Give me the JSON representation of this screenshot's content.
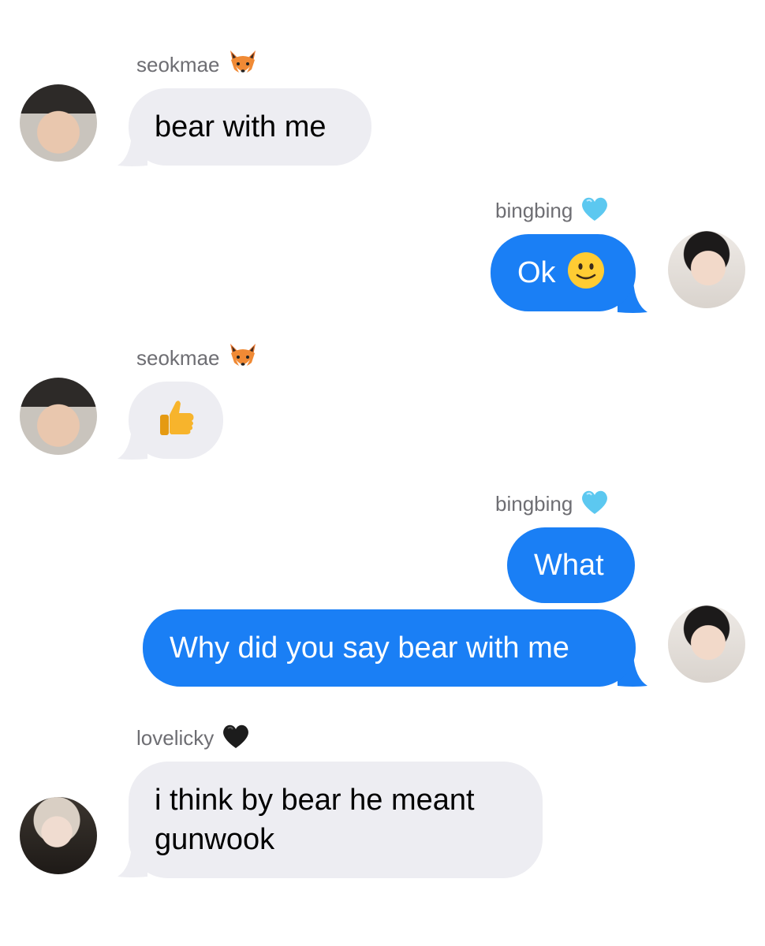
{
  "messages": [
    {
      "sender": "seokmae",
      "sender_icon": "fox-icon",
      "direction": "incoming",
      "text": "bear with me"
    },
    {
      "sender": "bingbing",
      "sender_icon": "light-blue-heart-icon",
      "direction": "outgoing",
      "text": "Ok",
      "emoji": "🙂"
    },
    {
      "sender": "seokmae",
      "sender_icon": "fox-icon",
      "direction": "incoming",
      "emoji": "👍"
    },
    {
      "sender": "bingbing",
      "sender_icon": "light-blue-heart-icon",
      "direction": "outgoing",
      "text": "What"
    },
    {
      "sender": "bingbing",
      "direction": "outgoing",
      "text": "Why did you say bear with me"
    },
    {
      "sender": "lovelicky",
      "sender_icon": "black-heart-icon",
      "direction": "incoming",
      "text": "i think by bear he meant gunwook"
    }
  ],
  "colors": {
    "incoming_bubble": "#ededf2",
    "outgoing_bubble": "#1a7ff5",
    "sender_text": "#6e6e73"
  }
}
